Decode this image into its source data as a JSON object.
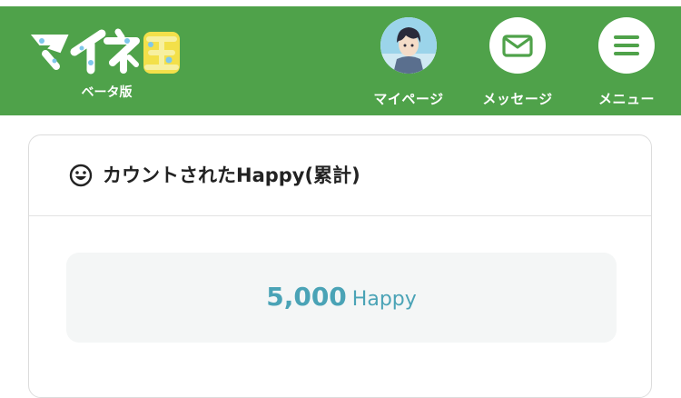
{
  "header": {
    "logo_text": "マイネ玉",
    "logo_badge": "ベータ版",
    "nav": {
      "mypage_label": "マイページ",
      "message_label": "メッセージ",
      "menu_label": "メニュー"
    }
  },
  "card": {
    "title": "カウントされたHappy(累計)",
    "count_value": "5,000",
    "count_unit": "Happy"
  },
  "colors": {
    "header_green": "#4fa24a",
    "count_blue": "#4aa3b6",
    "logo_yellow": "#f3e04a",
    "logo_blue": "#7fc7ea"
  }
}
